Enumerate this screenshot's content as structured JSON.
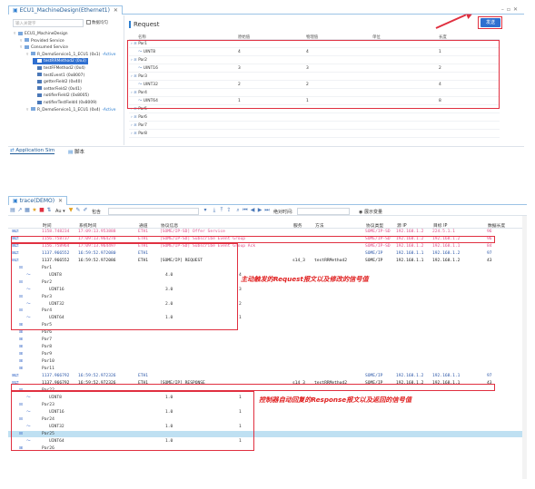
{
  "top": {
    "tab_label": "ECU1_MachineDesign(Ethernet1)",
    "search_placeholder": "输入关键字",
    "checkbox_label": "数据均匀",
    "tree": [
      {
        "label": "ECU1_MachineDesign",
        "indent": 0
      },
      {
        "label": "Provided Service",
        "indent": 1
      },
      {
        "label": "Consumed Service",
        "indent": 1
      },
      {
        "label": "R_DemoService1_1_ECU1 (0x1)",
        "tag": "-Active",
        "indent": 2
      },
      {
        "label": "testRRMethod2 (0x3)",
        "indent": 3,
        "selected": true
      },
      {
        "label": "testFFMethod2 (0x4)",
        "indent": 3
      },
      {
        "label": "testEvent1 (0x8007)",
        "indent": 3
      },
      {
        "label": "getterField2 (0x40)",
        "indent": 3
      },
      {
        "label": "setterField2 (0x41)",
        "indent": 3
      },
      {
        "label": "notifierField2 (0x8005)",
        "indent": 3
      },
      {
        "label": "notifierTestField4 (0x8009)",
        "indent": 3
      },
      {
        "label": "R_DemoService1_1_ECU1 (0x4)",
        "tag": "-Active",
        "indent": 2
      }
    ],
    "request_title": "Request",
    "send_label": "发送",
    "columns": [
      "名称",
      "原始值",
      "物理值",
      "单位",
      "长度"
    ],
    "rows": [
      {
        "name": "Par1",
        "raw": "",
        "phys": "",
        "unit": "",
        "len": "",
        "group": true
      },
      {
        "name": "UINT8",
        "raw": "4",
        "phys": "4",
        "unit": "",
        "len": "1",
        "group": false
      },
      {
        "name": "Par2",
        "raw": "",
        "phys": "",
        "unit": "",
        "len": "",
        "group": true
      },
      {
        "name": "UINT16",
        "raw": "3",
        "phys": "3",
        "unit": "",
        "len": "2",
        "group": false
      },
      {
        "name": "Par3",
        "raw": "",
        "phys": "",
        "unit": "",
        "len": "",
        "group": true
      },
      {
        "name": "UINT32",
        "raw": "2",
        "phys": "2",
        "unit": "",
        "len": "4",
        "group": false
      },
      {
        "name": "Par4",
        "raw": "",
        "phys": "",
        "unit": "",
        "len": "",
        "group": true
      },
      {
        "name": "UINT64",
        "raw": "1",
        "phys": "1",
        "unit": "",
        "len": "8",
        "group": false
      },
      {
        "name": "Par5",
        "raw": "",
        "phys": "",
        "unit": "",
        "len": "",
        "group": true
      },
      {
        "name": "Par6",
        "raw": "",
        "phys": "",
        "unit": "",
        "len": "",
        "group": true
      },
      {
        "name": "Par7",
        "raw": "",
        "phys": "",
        "unit": "",
        "len": "",
        "group": true
      },
      {
        "name": "Par8",
        "raw": "",
        "phys": "",
        "unit": "",
        "len": "",
        "group": true
      }
    ],
    "bottom_tabs": [
      "Application Sim",
      "脚本"
    ]
  },
  "trace": {
    "title": "trace(DEMO)",
    "toolbar": {
      "filter_label": "Au ▾",
      "match_label": "包含",
      "abs_time_label": "绝对时间:",
      "show_vars_label": "展示变量"
    },
    "headers": [
      "时间",
      "系统时间",
      "通道",
      "协议信息",
      "服务",
      "方法",
      "协议类型",
      "源 IP",
      "目标 IP",
      "数据长度"
    ],
    "rows": [
      {
        "expand": "⊞",
        "time": "1158.748234",
        "sys": "17:09:13.953888",
        "ch": "ETH1",
        "info": "[SOME/IP-SD] Offer Service",
        "svc": "",
        "method": "",
        "proto": "SOME/IP-SD",
        "src": "192.168.1.2",
        "dst": "224.5.1.1",
        "len": "96",
        "color": "pink"
      },
      {
        "expand": "⊞",
        "time": "1156.758737",
        "sys": "17:09:13.964270",
        "ch": "ETH1",
        "info": "[SOME/IP-SD] Subscribe Event Group",
        "svc": "",
        "method": "",
        "proto": "SOME/IP-SD",
        "src": "192.168.1.2",
        "dst": "192.168.1.2",
        "len": "96",
        "color": "pink"
      },
      {
        "expand": "⊞",
        "time": "1156.758964",
        "sys": "17:09:13.964497",
        "ch": "ETH1",
        "info": "[SOME/IP-SD] Subscribe Event Group Ack",
        "svc": "",
        "method": "",
        "proto": "SOME/IP-SD",
        "src": "192.168.1.2",
        "dst": "192.168.1.1",
        "len": "84",
        "color": "pink"
      },
      {
        "expand": "⊞",
        "time": "1137.966552",
        "sys": "16:59:52.972080",
        "ch": "ETH1",
        "info": "",
        "svc": "",
        "method": "",
        "proto": "SOME/IP",
        "src": "192.168.1.1",
        "dst": "192.168.1.2",
        "len": "97",
        "color": "blue"
      },
      {
        "expand": "⊟",
        "time": "1137.966552",
        "sys": "16:59:52.972086",
        "ch": "ETH1",
        "info": "[SOME/IP] REQUEST",
        "svc": "s14_3",
        "method": "testRRMethod2",
        "proto": "SOME/IP",
        "src": "192.168.1.1",
        "dst": "192.168.1.2",
        "len": "43",
        "color": "black"
      },
      {
        "expand": "⊟",
        "name": "Par1",
        "depth": 1
      },
      {
        "expand": "",
        "name": "UINT8",
        "raw": "4.0",
        "phys": "4",
        "depth": 2
      },
      {
        "expand": "⊟",
        "name": "Par2",
        "depth": 1
      },
      {
        "expand": "",
        "name": "UINT16",
        "raw": "3.0",
        "phys": "3",
        "depth": 2
      },
      {
        "expand": "⊟",
        "name": "Par3",
        "depth": 1
      },
      {
        "expand": "",
        "name": "UINT32",
        "raw": "2.0",
        "phys": "2",
        "depth": 2
      },
      {
        "expand": "⊟",
        "name": "Par4",
        "depth": 1
      },
      {
        "expand": "",
        "name": "UINT64",
        "raw": "1.0",
        "phys": "1",
        "depth": 2
      },
      {
        "expand": "⊞",
        "name": "Par5",
        "depth": 1
      },
      {
        "expand": "⊞",
        "name": "Par6",
        "depth": 1
      },
      {
        "expand": "⊞",
        "name": "Par7",
        "depth": 1
      },
      {
        "expand": "⊞",
        "name": "Par8",
        "depth": 1
      },
      {
        "expand": "⊞",
        "name": "Par9",
        "depth": 1
      },
      {
        "expand": "⊞",
        "name": "Par10",
        "depth": 1
      },
      {
        "expand": "⊞",
        "name": "Par11",
        "depth": 1
      },
      {
        "expand": "⊞",
        "time": "1137.966792",
        "sys": "16:59:52.972326",
        "ch": "ETH1",
        "info": "",
        "svc": "",
        "method": "",
        "proto": "SOME/IP",
        "src": "192.168.1.2",
        "dst": "192.168.1.1",
        "len": "97",
        "color": "blue"
      },
      {
        "expand": "⊟",
        "time": "1137.966792",
        "sys": "16:59:52.972326",
        "ch": "ETH1",
        "info": "[SOME/IP] RESPONSE",
        "svc": "s14_3",
        "method": "testRRMethod2",
        "proto": "SOME/IP",
        "src": "192.168.1.2",
        "dst": "192.168.1.1",
        "len": "43",
        "color": "black"
      },
      {
        "expand": "⊟",
        "name": "Par22",
        "depth": 1
      },
      {
        "expand": "",
        "name": "UINT8",
        "raw": "1.0",
        "phys": "1",
        "depth": 2
      },
      {
        "expand": "⊟",
        "name": "Par23",
        "depth": 1
      },
      {
        "expand": "",
        "name": "UINT16",
        "raw": "1.0",
        "phys": "1",
        "depth": 2
      },
      {
        "expand": "⊟",
        "name": "Par24",
        "depth": 1
      },
      {
        "expand": "",
        "name": "UINT32",
        "raw": "1.0",
        "phys": "1",
        "depth": 2
      },
      {
        "expand": "⊟",
        "name": "Par25",
        "depth": 1,
        "highlight": true
      },
      {
        "expand": "",
        "name": "UINT64",
        "raw": "1.0",
        "phys": "1",
        "depth": 2
      },
      {
        "expand": "⊞",
        "name": "Par26",
        "depth": 1
      }
    ],
    "annotation_request": "主动触发的Request报文以及修改的信号值",
    "annotation_response": "控制器自动回复的Response报文以及返回的信号值"
  },
  "colors": {
    "accent": "#2f6fd0",
    "annotation_red": "#e03040",
    "sd_pink": "#e0508a",
    "someip_blue": "#2c57a8",
    "highlight": "#bfe0f2"
  }
}
